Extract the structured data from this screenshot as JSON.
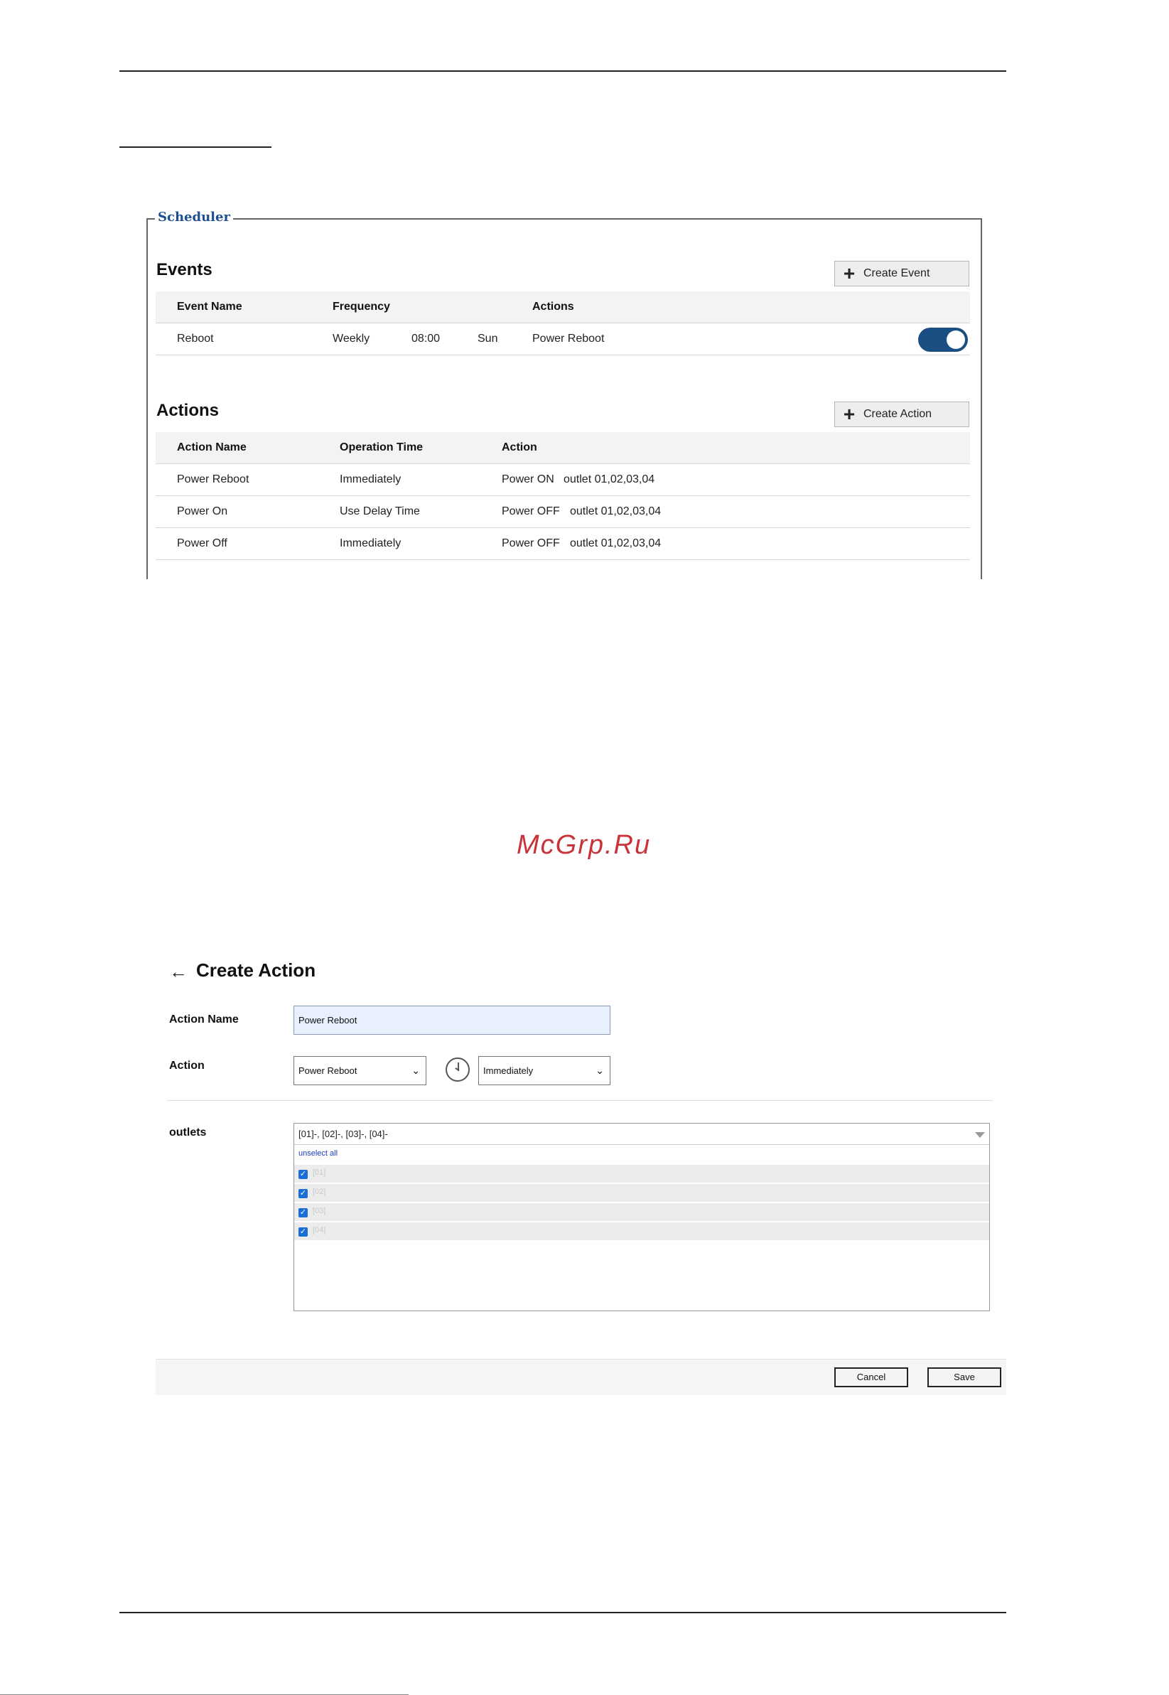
{
  "scheduler": {
    "legend": "Scheduler",
    "events": {
      "title": "Events",
      "create_label": "Create Event",
      "headers": [
        "Event Name",
        "Frequency",
        "Actions"
      ],
      "rows": [
        {
          "name": "Reboot",
          "frequency": "Weekly",
          "time": "08:00",
          "day": "Sun",
          "action": "Power Reboot",
          "enabled": true
        }
      ]
    },
    "actions": {
      "title": "Actions",
      "create_label": "Create Action",
      "headers": [
        "Action Name",
        "Operation Time",
        "Action"
      ],
      "rows": [
        {
          "name": "Power Reboot",
          "op_time": "Immediately",
          "action": "Power ON",
          "outlets": "outlet 01,02,03,04"
        },
        {
          "name": "Power On",
          "op_time": "Use Delay Time",
          "action": "Power OFF",
          "outlets": "outlet 01,02,03,04"
        },
        {
          "name": "Power Off",
          "op_time": "Immediately",
          "action": "Power OFF",
          "outlets": "outlet 01,02,03,04"
        }
      ]
    }
  },
  "watermark": "McGrp.Ru",
  "create_action": {
    "title": "Create Action",
    "back_icon": "arrow-left-icon",
    "action_name_label": "Action Name",
    "action_name_value": "Power Reboot",
    "action_label": "Action",
    "action_select": "Power Reboot",
    "time_select": "Immediately",
    "outlets_label": "outlets",
    "outlets_summary": "[01]-, [02]-, [03]-, [04]-",
    "unselect_all": "unselect all",
    "options": [
      {
        "label": "[01]",
        "checked": true
      },
      {
        "label": "[02]",
        "checked": true
      },
      {
        "label": "[03]",
        "checked": true
      },
      {
        "label": "[04]",
        "checked": true
      }
    ],
    "cancel_label": "Cancel",
    "save_label": "Save"
  },
  "colors": {
    "toggle_on": "#1b4e82",
    "legend": "#1f4f93",
    "watermark": "#c8343a",
    "checkbox": "#1a6fd6"
  }
}
